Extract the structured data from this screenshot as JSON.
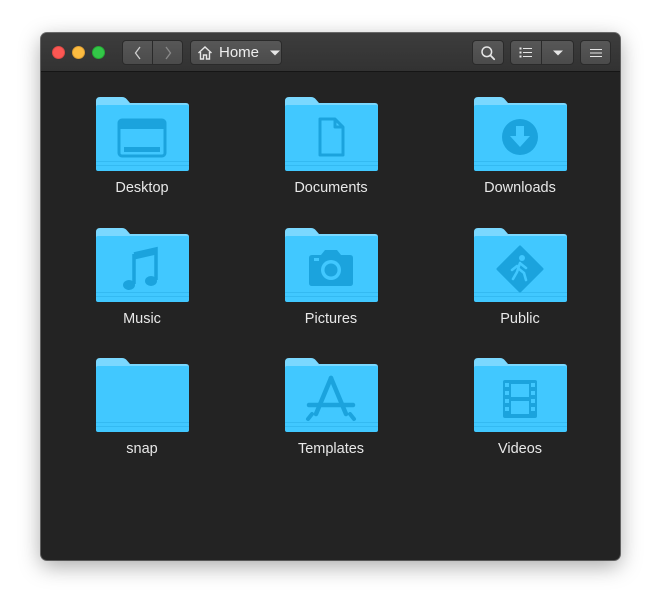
{
  "window": {
    "controls": [
      "close",
      "minimize",
      "maximize"
    ]
  },
  "toolbar": {
    "back_icon": "chevron-left-icon",
    "forward_icon": "chevron-right-icon",
    "location": {
      "icon": "home-icon",
      "label": "Home",
      "dropdown_icon": "caret-down-icon"
    },
    "search_icon": "search-icon",
    "view_icon": "list-view-icon",
    "view_menu_icon": "caret-down-icon",
    "menu_icon": "hamburger-menu-icon"
  },
  "colors": {
    "window_bg": "#232323",
    "titlebar": "#3a3a3a",
    "folder_main": "#41c8ff",
    "folder_tab": "#7ad8ff",
    "folder_emblem": "#1ba3dd",
    "label_text": "#e8e8e8",
    "close": "#fc5753",
    "minimize": "#fdbc40",
    "maximize": "#33c748"
  },
  "folders": [
    {
      "label": "Desktop",
      "emblem": "desktop-icon"
    },
    {
      "label": "Documents",
      "emblem": "document-icon"
    },
    {
      "label": "Downloads",
      "emblem": "download-icon"
    },
    {
      "label": "Music",
      "emblem": "music-note-icon"
    },
    {
      "label": "Pictures",
      "emblem": "camera-icon"
    },
    {
      "label": "Public",
      "emblem": "pedestrian-sign-icon"
    },
    {
      "label": "snap",
      "emblem": ""
    },
    {
      "label": "Templates",
      "emblem": "app-store-icon"
    },
    {
      "label": "Videos",
      "emblem": "film-strip-icon"
    }
  ]
}
